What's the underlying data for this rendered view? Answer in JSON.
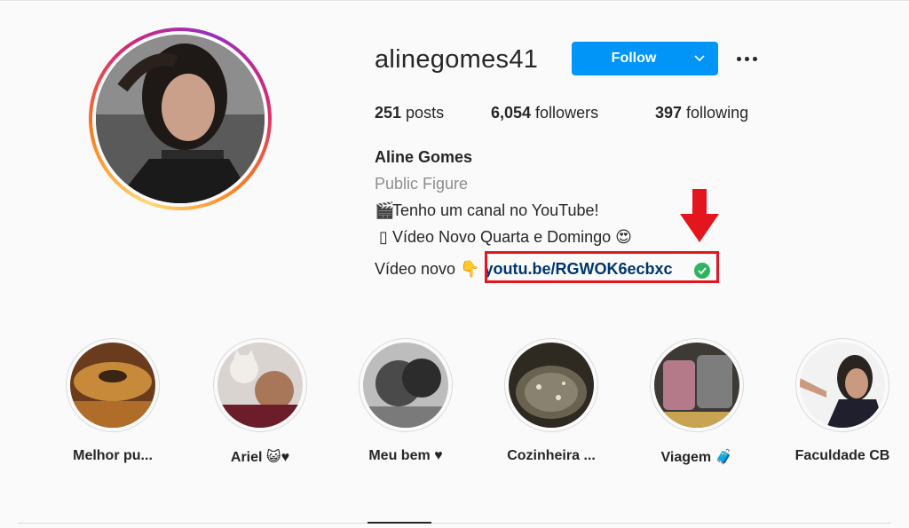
{
  "profile": {
    "username": "alinegomes41",
    "follow_label": "Follow",
    "stats": {
      "posts_count": "251",
      "posts_label": " posts",
      "followers_count": "6,054",
      "followers_label": " followers",
      "following_count": "397",
      "following_label": " following"
    },
    "bio": {
      "name": "Aline Gomes",
      "category": "Public Figure",
      "line1_emoji": "🎬",
      "line1_text": "Tenho um canal no YouTube!",
      "line2_emoji": "▯",
      "line2_text": "Vídeo Novo Quarta e Domingo ",
      "line2_end_emoji": "😍",
      "line3_text": "Vídeo novo ",
      "line3_emoji": "👇",
      "link": "youtu.be/RGWOK6ecbxc"
    }
  },
  "highlights": [
    {
      "label": "Melhor pu...",
      "icon": "food-photo"
    },
    {
      "label": "Ariel 😺♥",
      "icon": "cat-photo"
    },
    {
      "label": "Meu bem ♥",
      "icon": "portrait-photo"
    },
    {
      "label": "Cozinheira ...",
      "icon": "cooking-photo"
    },
    {
      "label": "Viagem 🧳",
      "icon": "luggage-photo"
    },
    {
      "label": "Faculdade CB",
      "icon": "selfie-photo"
    }
  ],
  "colors": {
    "follow_button": "#0095f6",
    "link": "#00376b",
    "annotation_red": "#e3151d",
    "verified_check": "#2db55d"
  }
}
